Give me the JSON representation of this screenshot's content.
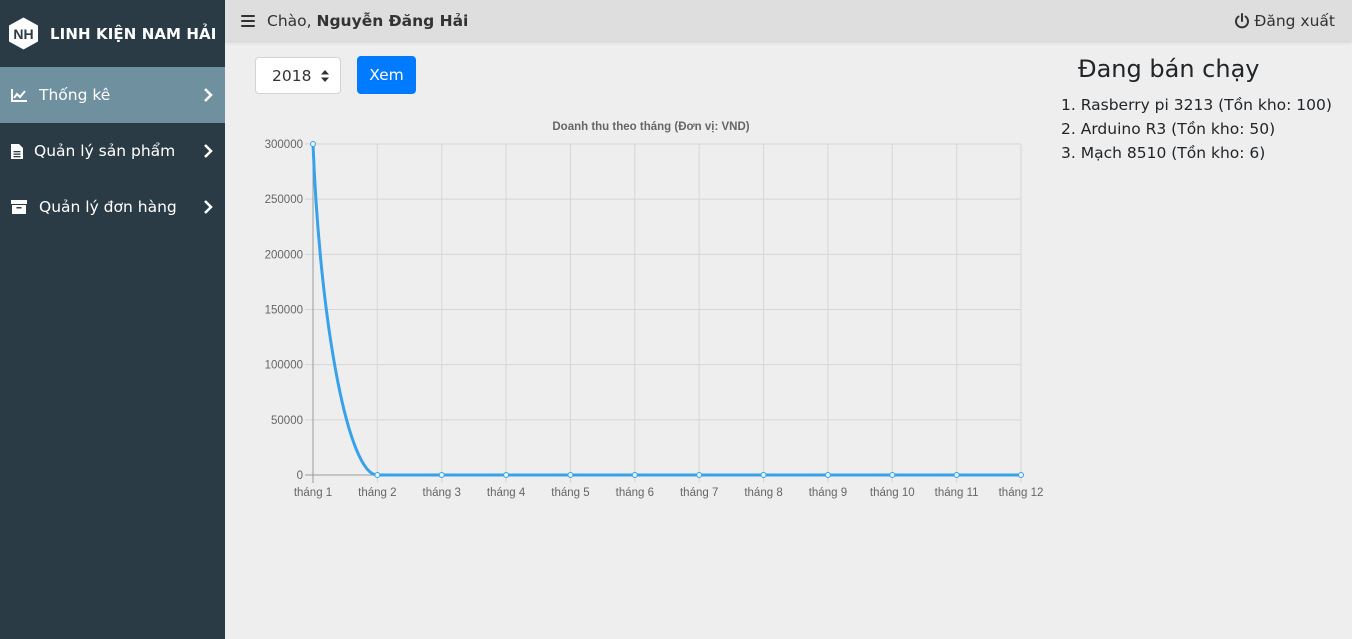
{
  "brand": {
    "name": "LINH KIỆN NAM HẢI",
    "logo_text": "NH"
  },
  "sidebar": {
    "items": [
      {
        "label": "Thống kê",
        "icon": "chart-line-icon",
        "active": true
      },
      {
        "label": "Quản lý sản phẩm",
        "icon": "file-icon",
        "active": false
      },
      {
        "label": "Quản lý đơn hàng",
        "icon": "archive-box-icon",
        "active": false
      }
    ]
  },
  "topbar": {
    "greeting_prefix": "Chào, ",
    "user_name": "Nguyễn Đăng Hải",
    "logout_label": "Đăng xuất"
  },
  "filter": {
    "year_value": "2018",
    "view_button_label": "Xem"
  },
  "best_sellers": {
    "title": "Đang bán chạy",
    "items": [
      "1. Rasberry pi 3213 (Tồn kho: 100)",
      "2. Arduino R3 (Tồn kho: 50)",
      "3. Mạch 8510 (Tồn kho: 6)"
    ]
  },
  "colors": {
    "sidebar_bg": "#2b3b45",
    "active_item_bg": "#6f919f",
    "topbar_bg": "#dedede",
    "button_primary": "#007bff",
    "line_color": "#36a2eb",
    "page_bg": "#eeeeee"
  },
  "chart_data": {
    "type": "line",
    "title": "Doanh thu theo tháng (Đơn vị: VND)",
    "categories": [
      "tháng 1",
      "tháng 2",
      "tháng 3",
      "tháng 4",
      "tháng 5",
      "tháng 6",
      "tháng 7",
      "tháng 8",
      "tháng 9",
      "tháng 10",
      "tháng 11",
      "tháng 12"
    ],
    "series": [
      {
        "values": [
          300000,
          0,
          0,
          0,
          0,
          0,
          0,
          0,
          0,
          0,
          0,
          0
        ]
      }
    ],
    "yticks": [
      "0",
      "50000",
      "100000",
      "150000",
      "200000",
      "250000",
      "300000"
    ],
    "ylim": [
      0,
      300000
    ],
    "xlabel": "",
    "ylabel": "",
    "grid": true,
    "legend": "none"
  }
}
